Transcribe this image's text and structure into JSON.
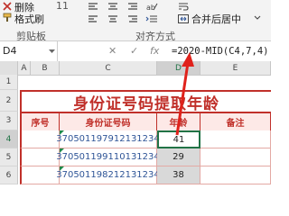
{
  "ribbon": {
    "delete_label": "删除",
    "format_brush_label": "格式刷",
    "clipboard_group": "剪贴板",
    "align_group": "对齐方式",
    "merge_center_label": "合并后居中",
    "font_size": "11"
  },
  "formula_bar": {
    "namebox": "D4",
    "cancel": "✕",
    "confirm": "✓",
    "fx": "fx",
    "formula": "=2020-MID(C4,7,4)"
  },
  "columns": [
    "A",
    "B",
    "C",
    "D",
    "E"
  ],
  "rows": [
    "1",
    "2",
    "3",
    "4",
    "5",
    "6"
  ],
  "sheet": {
    "title": "身份证号码提取年龄",
    "headers": {
      "seq": "序号",
      "id": "身份证号码",
      "age": "年龄",
      "note": "备注"
    },
    "data": [
      {
        "seq": "",
        "id": "370501197912131234",
        "age": "41"
      },
      {
        "seq": "",
        "id": "370501199110131234",
        "age": "29"
      },
      {
        "seq": "",
        "id": "370501198212131234",
        "age": "38"
      }
    ]
  },
  "colors": {
    "accent": "#c0302a",
    "header_fill": "#fde9e7",
    "id_text": "#2f5597"
  }
}
